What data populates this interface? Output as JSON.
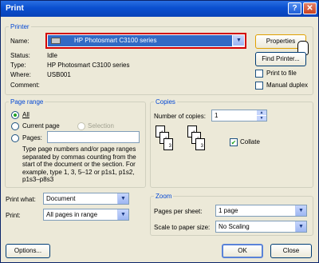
{
  "window": {
    "title": "Print",
    "help_label": "?",
    "close_label": "✕"
  },
  "printer": {
    "legend": "Printer",
    "name_label": "Name:",
    "name_value": "HP Photosmart C3100 series",
    "status_label": "Status:",
    "status_value": "Idle",
    "type_label": "Type:",
    "type_value": "HP Photosmart C3100 series",
    "where_label": "Where:",
    "where_value": "USB001",
    "comment_label": "Comment:",
    "properties_label": "Properties",
    "find_printer_label": "Find Printer...",
    "print_to_file_label": "Print to file",
    "manual_duplex_label": "Manual duplex"
  },
  "page_range": {
    "legend": "Page range",
    "all_label": "All",
    "current_page_label": "Current page",
    "selection_label": "Selection",
    "pages_label": "Pages:",
    "help_text": "Type page numbers and/or page ranges separated by commas counting from the start of the document or the section. For example, type 1, 3, 5–12 or p1s1, p1s2, p1s3–p8s3"
  },
  "copies": {
    "legend": "Copies",
    "number_label": "Number of copies:",
    "number_value": "1",
    "collate_label": "Collate",
    "collate_checked": true
  },
  "print_what": {
    "label": "Print what:",
    "value": "Document"
  },
  "print_option": {
    "label": "Print:",
    "value": "All pages in range"
  },
  "zoom": {
    "legend": "Zoom",
    "pages_per_sheet_label": "Pages per sheet:",
    "pages_per_sheet_value": "1 page",
    "scale_label": "Scale to paper size:",
    "scale_value": "No Scaling"
  },
  "buttons": {
    "options": "Options...",
    "ok": "OK",
    "close": "Close"
  },
  "collate_pages": [
    "1",
    "2",
    "3",
    "1",
    "2",
    "3"
  ]
}
